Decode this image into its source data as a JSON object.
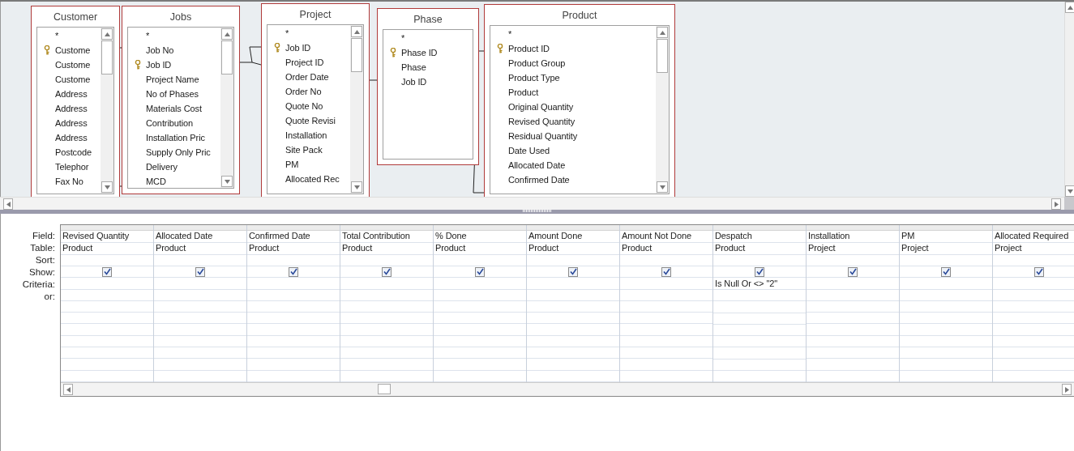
{
  "field_lists": [
    {
      "title": "Customer",
      "fields": [
        {
          "name": "*",
          "key": false
        },
        {
          "name": "Custome",
          "key": true
        },
        {
          "name": "Custome",
          "key": false
        },
        {
          "name": "Custome",
          "key": false
        },
        {
          "name": "Address",
          "key": false
        },
        {
          "name": "Address",
          "key": false
        },
        {
          "name": "Address",
          "key": false
        },
        {
          "name": "Address",
          "key": false
        },
        {
          "name": "Postcode",
          "key": false
        },
        {
          "name": "Telephor",
          "key": false
        },
        {
          "name": "Fax No",
          "key": false
        }
      ]
    },
    {
      "title": "Jobs",
      "fields": [
        {
          "name": "*",
          "key": false
        },
        {
          "name": "Job No",
          "key": false
        },
        {
          "name": "Job ID",
          "key": true
        },
        {
          "name": "Project Name",
          "key": false
        },
        {
          "name": "No of Phases",
          "key": false
        },
        {
          "name": "Materials Cost",
          "key": false
        },
        {
          "name": "Contribution",
          "key": false
        },
        {
          "name": "Installation Pric",
          "key": false
        },
        {
          "name": "Supply Only Pric",
          "key": false
        },
        {
          "name": "Delivery",
          "key": false
        },
        {
          "name": "MCD",
          "key": false
        }
      ]
    },
    {
      "title": "Project",
      "fields": [
        {
          "name": "*",
          "key": false
        },
        {
          "name": "Job ID",
          "key": true
        },
        {
          "name": "Project ID",
          "key": false
        },
        {
          "name": "Order Date",
          "key": false
        },
        {
          "name": "Order No",
          "key": false
        },
        {
          "name": "Quote No",
          "key": false
        },
        {
          "name": "Quote Revisi",
          "key": false
        },
        {
          "name": "Installation",
          "key": false
        },
        {
          "name": "Site Pack",
          "key": false
        },
        {
          "name": "PM",
          "key": false
        },
        {
          "name": "Allocated Rec",
          "key": false
        }
      ]
    },
    {
      "title": "Phase",
      "fields": [
        {
          "name": "*",
          "key": false
        },
        {
          "name": "Phase ID",
          "key": true
        },
        {
          "name": "Phase",
          "key": false
        },
        {
          "name": "Job ID",
          "key": false
        }
      ]
    },
    {
      "title": "Product",
      "fields": [
        {
          "name": "*",
          "key": false
        },
        {
          "name": "Product ID",
          "key": true
        },
        {
          "name": "Product Group",
          "key": false
        },
        {
          "name": "Product Type",
          "key": false
        },
        {
          "name": "Product",
          "key": false
        },
        {
          "name": "Original Quantity",
          "key": false
        },
        {
          "name": "Revised Quantity",
          "key": false
        },
        {
          "name": "Residual Quantity",
          "key": false
        },
        {
          "name": "Date Used",
          "key": false
        },
        {
          "name": "Allocated Date",
          "key": false
        },
        {
          "name": "Confirmed Date",
          "key": false
        }
      ]
    }
  ],
  "grid": {
    "row_labels": [
      "Field:",
      "Table:",
      "Sort:",
      "Show:",
      "Criteria:",
      "or:"
    ],
    "columns": [
      {
        "field": "Revised Quantity",
        "table": "Product",
        "show": true
      },
      {
        "field": "Allocated Date",
        "table": "Product",
        "show": true
      },
      {
        "field": "Confirmed Date",
        "table": "Product",
        "show": true
      },
      {
        "field": "Total Contribution",
        "table": "Product",
        "show": true
      },
      {
        "field": "% Done",
        "table": "Product",
        "show": true
      },
      {
        "field": "Amount Done",
        "table": "Product",
        "show": true
      },
      {
        "field": "Amount Not Done",
        "table": "Product",
        "show": true
      },
      {
        "field": "Despatch",
        "table": "Product",
        "show": true,
        "criteria": "Is Null Or <> \"2\""
      },
      {
        "field": "Installation",
        "table": "Project",
        "show": true
      },
      {
        "field": "PM",
        "table": "Project",
        "show": true
      },
      {
        "field": "Allocated Required",
        "table": "Project",
        "show": true
      }
    ]
  }
}
